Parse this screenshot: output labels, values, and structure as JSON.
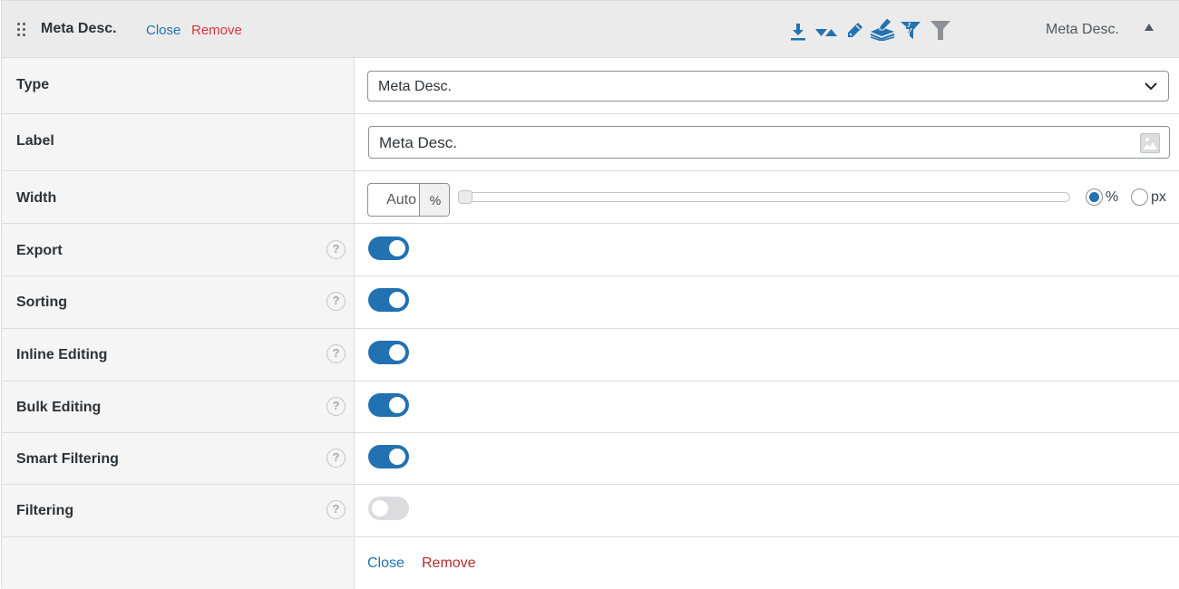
{
  "header": {
    "title": "Meta Desc.",
    "close_label": "Close",
    "remove_label": "Remove",
    "type_label": "Meta Desc.",
    "feature_icons": [
      {
        "name": "export-icon",
        "active": true
      },
      {
        "name": "sorting-icon",
        "active": true
      },
      {
        "name": "inline-edit-icon",
        "active": true
      },
      {
        "name": "bulk-edit-icon",
        "active": true
      },
      {
        "name": "smart-filter-icon",
        "active": true
      },
      {
        "name": "filter-icon",
        "active": false
      }
    ],
    "colors": {
      "active": "#2271b1",
      "inactive": "#8c8f94"
    }
  },
  "fields": {
    "type": {
      "label": "Type",
      "value": "Meta Desc."
    },
    "label": {
      "label": "Label",
      "value": "Meta Desc."
    },
    "width": {
      "label": "Width",
      "value": "Auto",
      "unit_display": "%",
      "slider_value": 0,
      "units": [
        "%",
        "px"
      ],
      "selected_unit": "%"
    }
  },
  "toggles": [
    {
      "label": "Export",
      "on": true
    },
    {
      "label": "Sorting",
      "on": true
    },
    {
      "label": "Inline Editing",
      "on": true
    },
    {
      "label": "Bulk Editing",
      "on": true
    },
    {
      "label": "Smart Filtering",
      "on": true
    },
    {
      "label": "Filtering",
      "on": false
    }
  ],
  "help_glyph": "?",
  "footer": {
    "close_label": "Close",
    "remove_label": "Remove"
  }
}
